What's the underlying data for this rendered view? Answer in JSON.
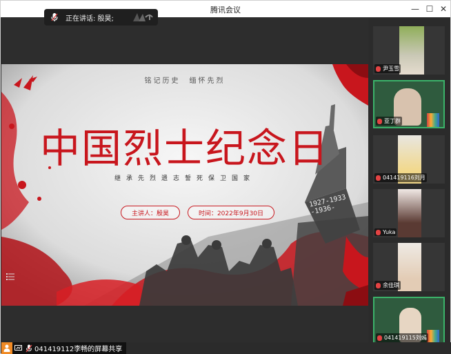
{
  "window": {
    "title": "腾讯会议",
    "minimize_glyph": "—",
    "maximize_glyph": "☐",
    "close_glyph": "✕"
  },
  "speaking_bar": {
    "label": "正在讲话: 殷昊;"
  },
  "slide": {
    "tagline": "铭记历史　缅怀先烈",
    "headline": "中国烈士纪念日",
    "subline": "继承先烈遗志誓死保卫国家",
    "speaker_pill": "主讲人：殷昊",
    "date_pill": "时间：2022年9月30日",
    "monument_text_1": "1927-1933",
    "monument_text_2": "-1936-"
  },
  "participants": [
    {
      "name": "尹玉雪"
    },
    {
      "name": "亚丁群"
    },
    {
      "name": "041419116刘月"
    },
    {
      "name": "Yuka"
    },
    {
      "name": "余佳琪"
    },
    {
      "name": "041419115刘嫣"
    }
  ],
  "share_bar": {
    "label": "041419112李畅的屏幕共享"
  },
  "colors": {
    "accent_red": "#c8161d",
    "active_border": "#3bb36a"
  }
}
